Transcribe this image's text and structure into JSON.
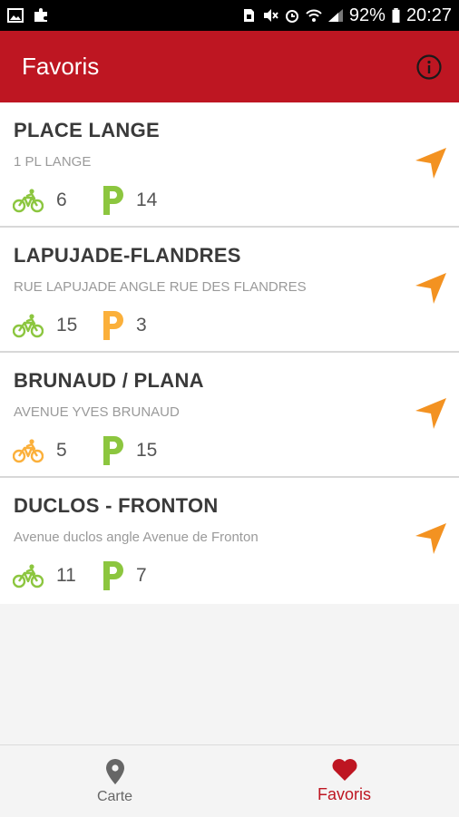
{
  "status_bar": {
    "battery": "92%",
    "time": "20:27"
  },
  "header": {
    "title": "Favoris",
    "info_icon": "info-icon"
  },
  "colors": {
    "brand": "#be1622",
    "bike_green": "#8cc63f",
    "orange": "#f39221",
    "amber": "#fbb03b"
  },
  "stations": [
    {
      "name": "PLACE LANGE",
      "address": "1 PL LANGE",
      "bikes": "6",
      "parking": "14",
      "bike_level": "ok",
      "park_level": "ok"
    },
    {
      "name": "LAPUJADE-FLANDRES",
      "address": "RUE LAPUJADE ANGLE RUE DES FLANDRES",
      "bikes": "15",
      "parking": "3",
      "bike_level": "ok",
      "park_level": "low"
    },
    {
      "name": "BRUNAUD / PLANA",
      "address": "AVENUE YVES BRUNAUD",
      "bikes": "5",
      "parking": "15",
      "bike_level": "low",
      "park_level": "ok"
    },
    {
      "name": "DUCLOS - FRONTON",
      "address": "Avenue duclos angle Avenue de Fronton",
      "bikes": "11",
      "parking": "7",
      "bike_level": "ok",
      "park_level": "ok"
    }
  ],
  "bottom_nav": {
    "carte": "Carte",
    "favoris": "Favoris"
  }
}
